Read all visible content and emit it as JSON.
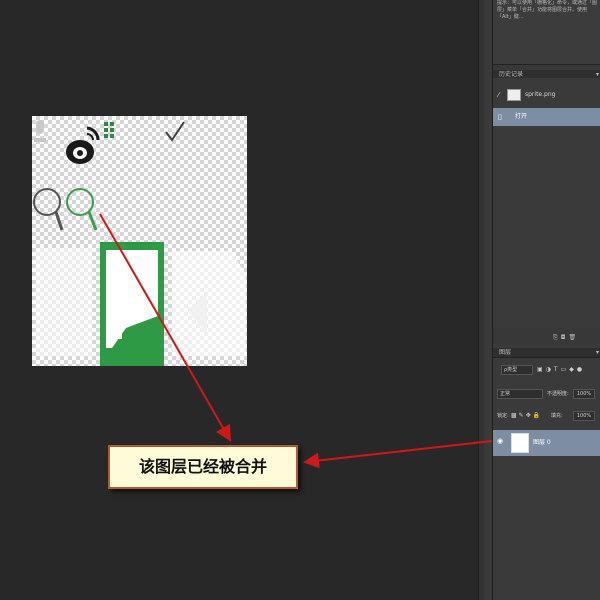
{
  "properties_text": "提示：可以使用「栅格化」命令，或通过「图层」菜单「合并」功能将图层合并。使用「Alt」键…",
  "history_panel": {
    "title": "历史记录",
    "rows": [
      {
        "label": "sprite.png",
        "selected": false
      },
      {
        "label": "打开",
        "selected": true
      }
    ]
  },
  "layers_panel": {
    "title": "图层",
    "kind_label": "ρ类型",
    "blend_mode": "正常",
    "opacity_label": "不透明度:",
    "opacity_value": "100%",
    "lock_label": "锁定:",
    "fill_label": "填充:",
    "fill_value": "100%",
    "layer_name": "图层 0"
  },
  "callout_text": "该图层已经被合并",
  "colors": {
    "accent_green": "#3a9d4c",
    "selection_blue": "#7d8ea3",
    "arrow_red": "#d01818"
  }
}
